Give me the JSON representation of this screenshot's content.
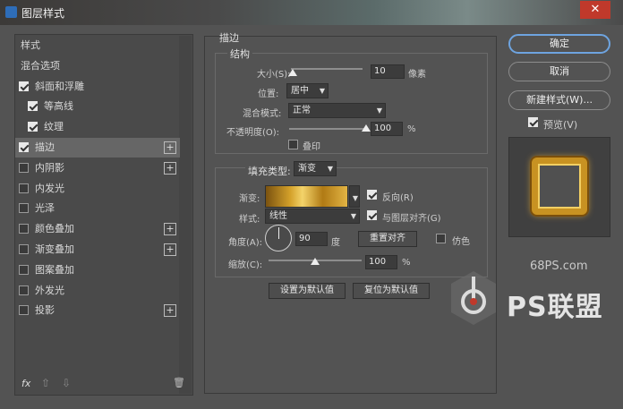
{
  "window": {
    "title": "图层样式",
    "close": "✕"
  },
  "sidebar": {
    "items": [
      {
        "label": "样式",
        "checkbox": false,
        "checked": false,
        "plus": false,
        "indent": false
      },
      {
        "label": "混合选项",
        "checkbox": false,
        "checked": false,
        "plus": false,
        "indent": false
      },
      {
        "label": "斜面和浮雕",
        "checkbox": true,
        "checked": true,
        "plus": false,
        "indent": false
      },
      {
        "label": "等高线",
        "checkbox": true,
        "checked": true,
        "plus": false,
        "indent": true
      },
      {
        "label": "纹理",
        "checkbox": true,
        "checked": true,
        "plus": false,
        "indent": true
      },
      {
        "label": "描边",
        "checkbox": true,
        "checked": true,
        "plus": true,
        "indent": false,
        "selected": true
      },
      {
        "label": "内阴影",
        "checkbox": true,
        "checked": false,
        "plus": true,
        "indent": false
      },
      {
        "label": "内发光",
        "checkbox": true,
        "checked": false,
        "plus": false,
        "indent": false
      },
      {
        "label": "光泽",
        "checkbox": true,
        "checked": false,
        "plus": false,
        "indent": false
      },
      {
        "label": "颜色叠加",
        "checkbox": true,
        "checked": false,
        "plus": true,
        "indent": false
      },
      {
        "label": "渐变叠加",
        "checkbox": true,
        "checked": false,
        "plus": true,
        "indent": false
      },
      {
        "label": "图案叠加",
        "checkbox": true,
        "checked": false,
        "plus": false,
        "indent": false
      },
      {
        "label": "外发光",
        "checkbox": true,
        "checked": false,
        "plus": false,
        "indent": false
      },
      {
        "label": "投影",
        "checkbox": true,
        "checked": false,
        "plus": true,
        "indent": false
      }
    ],
    "footer": {
      "fx": "fx",
      "up": "⇧",
      "down": "⇩",
      "trash": "🗑"
    }
  },
  "stroke": {
    "section_title": "描边",
    "structure_title": "结构",
    "size_label": "大小(S):",
    "size_value": "10",
    "size_unit": "像素",
    "size_level": 0.03,
    "position_label": "位置:",
    "position_value": "居中",
    "blend_label": "混合模式:",
    "blend_value": "正常",
    "opacity_label": "不透明度(O):",
    "opacity_value": "100",
    "opacity_unit": "%",
    "opacity_level": 1.0,
    "overprint_label": "叠印",
    "fill_type_label": "填充类型:",
    "fill_type_value": "渐变",
    "gradient_label": "渐变:",
    "reverse_label": "反向(R)",
    "style_label": "样式:",
    "style_value": "线性",
    "align_label": "与图层对齐(G)",
    "angle_label": "角度(A):",
    "angle_value": "90",
    "angle_unit": "度",
    "reset_align": "重置对齐",
    "dither_label": "仿色",
    "scale_label": "缩放(C):",
    "scale_value": "100",
    "scale_unit": "%",
    "scale_level": 0.5,
    "set_default": "设置为默认值",
    "reset_default": "复位为默认值"
  },
  "actions": {
    "ok": "确定",
    "cancel": "取消",
    "new_style": "新建样式(W)...",
    "preview_label": "预览(V)"
  },
  "watermark": {
    "site": "68PS.com",
    "brand": "PS联盟"
  },
  "colors": {
    "accent": "#6ea4e0",
    "close": "#c0392b",
    "gold": "#d4a12a"
  }
}
